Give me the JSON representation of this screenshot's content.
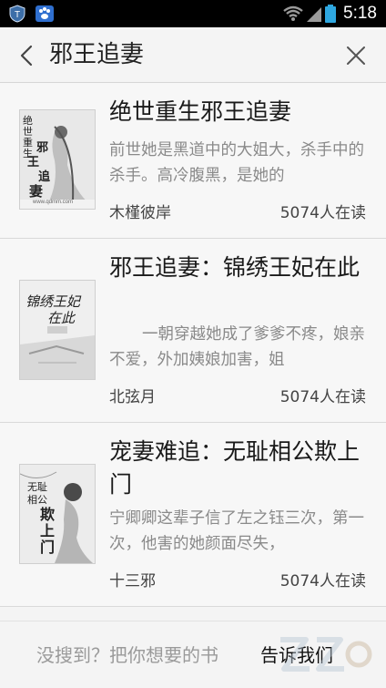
{
  "status_bar": {
    "time": "5:18",
    "left_icons": [
      "shield-notification-icon",
      "baidu-paw-icon"
    ],
    "right_icons": [
      "wifi-icon",
      "signal-icon",
      "battery-icon"
    ]
  },
  "search": {
    "query": "邪王追妻"
  },
  "results": [
    {
      "title": "绝世重生邪王追妻",
      "description": "前世她是黑道中的大姐大，杀手中的杀手。高冷腹黑，是她的",
      "author": "木槿彼岸",
      "readers": "5074人在读",
      "cover_text": [
        "绝世重生",
        "邪",
        "王",
        "追",
        "妻"
      ],
      "cover_site": "www.qdmm.com"
    },
    {
      "title": "邪王追妻：锦绣王妃在此",
      "description": "一朝穿越她成了爹爹不疼，娘亲不爱，外加姨娘加害，姐",
      "author": "北弦月",
      "readers": "5074人在读",
      "cover_text": [
        "锦绣王妃",
        "在此"
      ]
    },
    {
      "title": "宠妻难追：无耻相公欺上门",
      "description": "宁卿卿这辈子信了左之钰三次，第一次，他害的她颜面尽失，",
      "author": "十三邪",
      "readers": "5074人在读",
      "cover_text": [
        "无耻",
        "相公",
        "欺上门"
      ]
    }
  ],
  "footer": {
    "prompt": "没搜到？把你想要的书",
    "link": "告诉我们"
  },
  "colors": {
    "status_bar": "#000000",
    "background": "#f4f4f4",
    "divider": "#d9d9d9",
    "title": "#1a1a1a",
    "description": "#8a8a8a"
  }
}
